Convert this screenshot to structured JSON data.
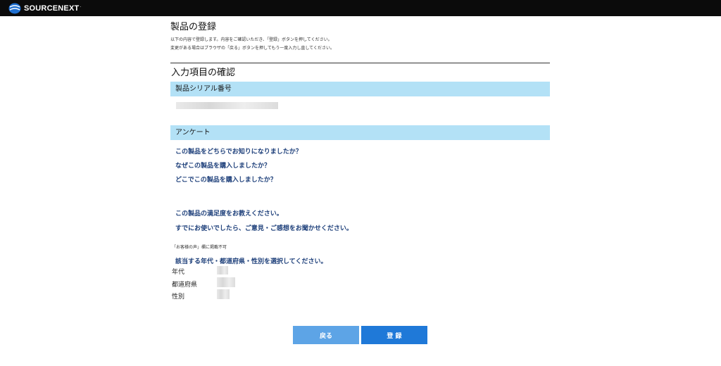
{
  "header": {
    "brand": "SOURCENEXT",
    "brand_mark": "."
  },
  "page": {
    "title": "製品の登録",
    "instructions": [
      "以下の内容で登録します。内容をご確認いただき、「登録」ボタンを押してください。",
      "変更がある場合はブラウザの「戻る」ボタンを押してもう一度入力し直してください。"
    ],
    "section_title": "入力項目の確認"
  },
  "serial": {
    "label": "製品シリアル番号"
  },
  "survey": {
    "label": "アンケート",
    "questions": [
      "この製品をどちらでお知りになりましたか？",
      "なぜこの製品を購入しましたか？",
      "どこでこの製品を購入しましたか？",
      "この製品の満足度をお教えください。",
      "すでにお使いでしたら、ご意見・ご感想をお聞かせください。"
    ],
    "note": "「お客様の声」欄に掲載不可",
    "demographics_question": "該当する年代・都道府県・性別を選択してください。",
    "fields": {
      "age": "年代",
      "prefecture": "都道府県",
      "gender": "性別"
    }
  },
  "buttons": {
    "back": "戻る",
    "submit": "登 録"
  }
}
